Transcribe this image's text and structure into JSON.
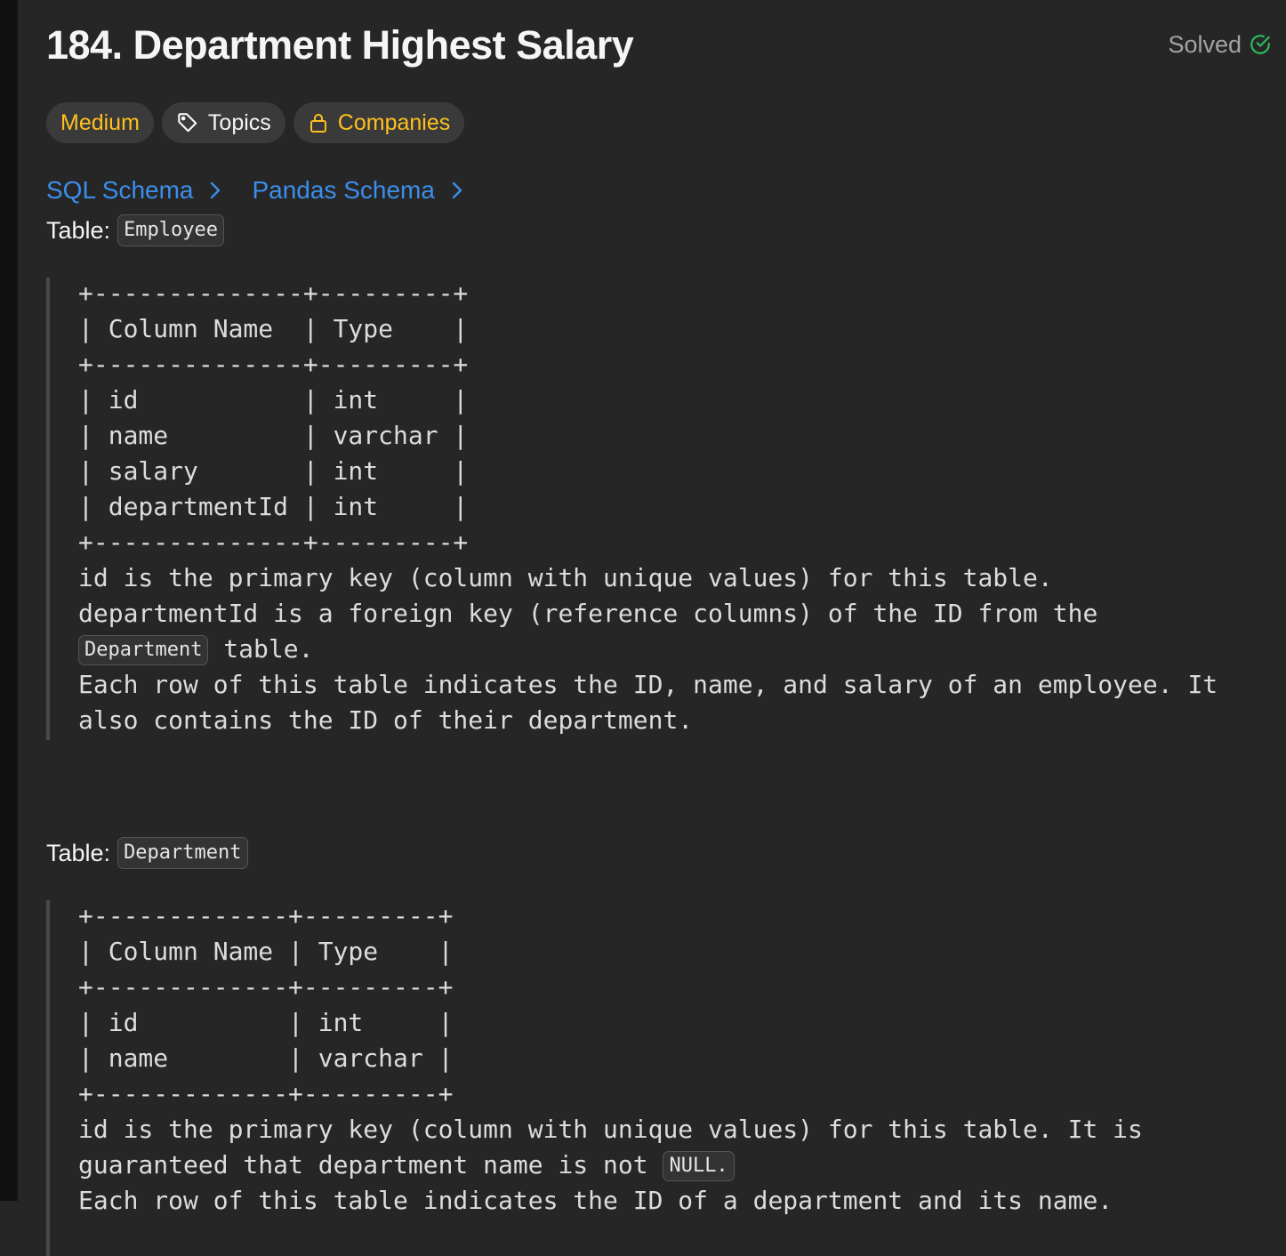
{
  "problem": {
    "title": "184. Department Highest Salary",
    "status": "Solved",
    "status_icon": "check-circle-icon",
    "status_color": "#2cbb5d"
  },
  "tags": {
    "difficulty": "Medium",
    "difficulty_color": "#ffc01e",
    "topics": "Topics",
    "topics_icon": "tag-icon",
    "companies": "Companies",
    "companies_icon": "lock-icon"
  },
  "schema_links": [
    {
      "label": "SQL Schema",
      "icon": "chevron-right-icon"
    },
    {
      "label": "Pandas Schema",
      "icon": "chevron-right-icon"
    }
  ],
  "employee": {
    "label": "Table:",
    "name": "Employee",
    "schema": "+--------------+---------+\n| Column Name  | Type    |\n+--------------+---------+\n| id           | int     |\n| name         | varchar |\n| salary       | int     |\n| departmentId | int     |\n+--------------+---------+",
    "line1": "id is the primary key (column with unique values) for this table.",
    "line2_before": "departmentId is a foreign key (reference columns) of the ID from the ",
    "line2_code": "Department",
    "line2_after": " table.",
    "line3": "Each row of this table indicates the ID, name, and salary of an employee. It also contains the ID of their department."
  },
  "department": {
    "label": "Table:",
    "name": "Department",
    "schema": "+-------------+---------+\n| Column Name | Type    |\n+-------------+---------+\n| id          | int     |\n| name        | varchar |\n+-------------+---------+",
    "line1_before": "id is the primary key (column with unique values) for this table. It is guaranteed that department name is not ",
    "line1_code": "NULL.",
    "line2": "Each row of this table indicates the ID of a department and its name."
  }
}
